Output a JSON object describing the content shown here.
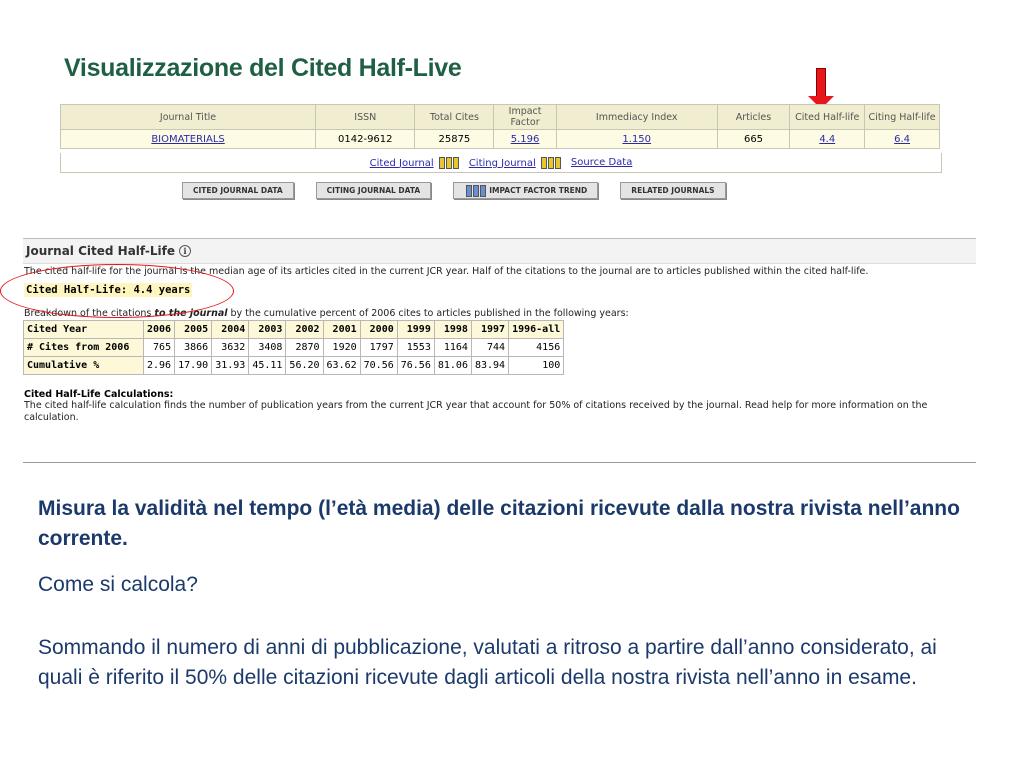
{
  "slide": {
    "title": "Visualizzazione del Cited Half-Live",
    "paragraph_bold": "Misura la validità nel tempo (l’età media) delle citazioni ricevute dalla nostra rivista nell’anno corrente.",
    "question": "Come si calcola?",
    "explanation": "Sommando il numero di anni di pubblicazione, valutati a ritroso a partire dall’anno considerato, ai quali è riferito il 50% delle citazioni ricevute dagli articoli della nostra rivista nell’anno in esame."
  },
  "journal_table": {
    "headers": [
      "Journal Title",
      "ISSN",
      "Total Cites",
      "Impact Factor",
      "Immediacy Index",
      "Articles",
      "Cited Half-life",
      "Citing Half-life"
    ],
    "row": {
      "title": "BIOMATERIALS",
      "issn": "0142-9612",
      "total_cites": "25875",
      "impact_factor": "5.196",
      "immediacy_index": "1.150",
      "articles": "665",
      "cited_half_life": "4.4",
      "citing_half_life": "6.4"
    },
    "links": [
      "Cited Journal",
      "Citing Journal",
      "Source Data"
    ]
  },
  "buttons": [
    "CITED JOURNAL DATA",
    "CITING JOURNAL DATA",
    "IMPACT FACTOR TREND",
    "RELATED JOURNALS"
  ],
  "half_life": {
    "header": "Journal Cited Half-Life",
    "description": "The cited half-life for the journal is the median age of its articles cited in the current JCR year. Half of the citations to the journal are to articles published within the cited half-life.",
    "value_text": "Cited Half-Life: 4.4 years",
    "breakdown_pre": "Breakdown of the citations ",
    "breakdown_em": "to the journal",
    "breakdown_post": " by the cumulative percent of 2006 cites to articles published in the following years:",
    "rows": [
      {
        "label": "Cited Year",
        "cells": [
          "2006",
          "2005",
          "2004",
          "2003",
          "2002",
          "2001",
          "2000",
          "1999",
          "1998",
          "1997",
          "1996-all"
        ]
      },
      {
        "label": "# Cites from 2006",
        "cells": [
          "765",
          "3866",
          "3632",
          "3408",
          "2870",
          "1920",
          "1797",
          "1553",
          "1164",
          "744",
          "4156"
        ]
      },
      {
        "label": "Cumulative %",
        "cells": [
          "2.96",
          "17.90",
          "31.93",
          "45.11",
          "56.20",
          "63.62",
          "70.56",
          "76.56",
          "81.06",
          "83.94",
          "100"
        ]
      }
    ],
    "calc_title": "Cited Half-Life Calculations:",
    "calc_desc": "The cited half-life calculation finds the number of publication years from the current JCR year that account for 50% of citations received by the journal. Read help for more information on the calculation."
  },
  "colors": {
    "title": "#1f5f43",
    "body_text": "#1b3a6b",
    "highlight": "#e3141b"
  }
}
